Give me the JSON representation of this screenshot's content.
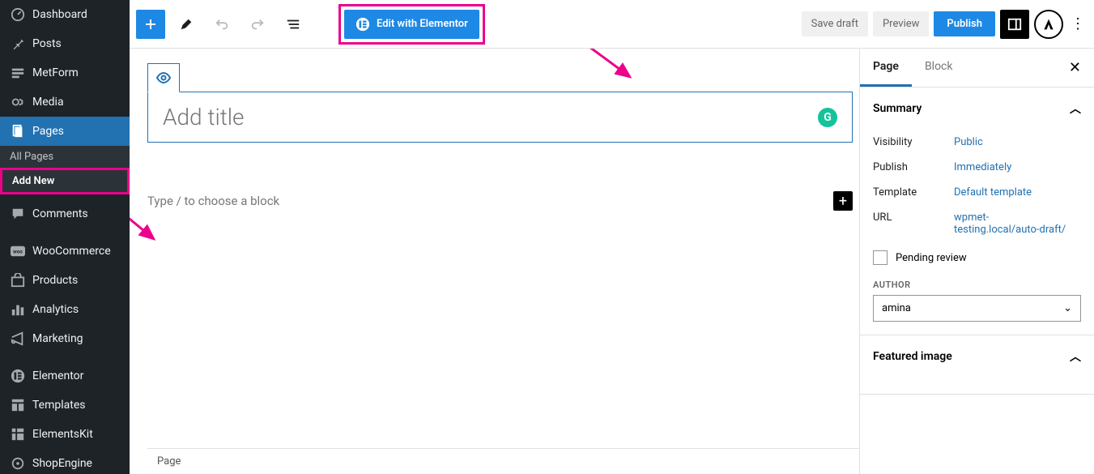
{
  "sidebar": {
    "items": [
      {
        "label": "Dashboard",
        "icon": "dashboard"
      },
      {
        "label": "Posts",
        "icon": "pin"
      },
      {
        "label": "MetForm",
        "icon": "metform"
      },
      {
        "label": "Media",
        "icon": "media"
      },
      {
        "label": "Pages",
        "icon": "pages",
        "active": true
      },
      {
        "label": "Comments",
        "icon": "comment"
      },
      {
        "label": "WooCommerce",
        "icon": "woo"
      },
      {
        "label": "Products",
        "icon": "products"
      },
      {
        "label": "Analytics",
        "icon": "analytics"
      },
      {
        "label": "Marketing",
        "icon": "marketing"
      },
      {
        "label": "Elementor",
        "icon": "elementor"
      },
      {
        "label": "Templates",
        "icon": "templates"
      },
      {
        "label": "ElementsKit",
        "icon": "elementskit"
      },
      {
        "label": "ShopEngine",
        "icon": "shopengine"
      }
    ],
    "sub": [
      {
        "label": "All Pages"
      },
      {
        "label": "Add New",
        "current": true
      }
    ]
  },
  "topbar": {
    "elementor_label": "Edit with Elementor",
    "save_draft": "Save draft",
    "preview": "Preview",
    "publish": "Publish"
  },
  "editor": {
    "title_placeholder": "Add title",
    "block_placeholder": "Type / to choose a block"
  },
  "settings": {
    "tabs": {
      "page": "Page",
      "block": "Block"
    },
    "summary": {
      "heading": "Summary",
      "visibility": {
        "label": "Visibility",
        "value": "Public"
      },
      "publish": {
        "label": "Publish",
        "value": "Immediately"
      },
      "template": {
        "label": "Template",
        "value": "Default template"
      },
      "url": {
        "label": "URL",
        "value": "wpmet-testing.local/auto-draft/"
      },
      "pending": "Pending review",
      "author_label": "AUTHOR",
      "author_value": "amina"
    },
    "featured": {
      "heading": "Featured image"
    }
  },
  "footer": {
    "breadcrumb": "Page"
  },
  "grammarly": "G"
}
